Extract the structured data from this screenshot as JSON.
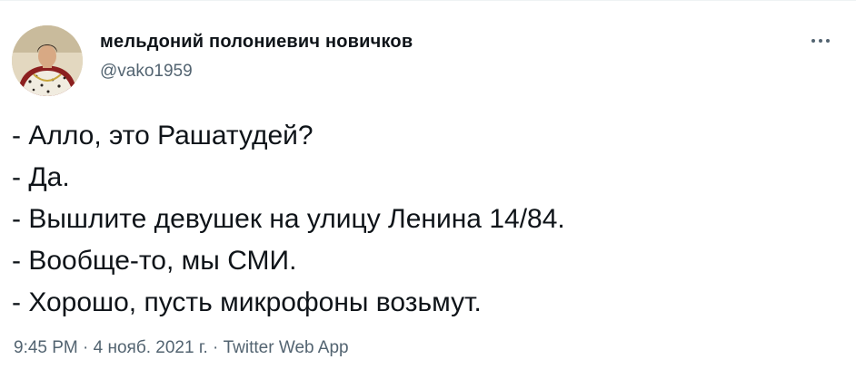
{
  "author": {
    "name": "мельдоний полониевич новичков",
    "handle": "@vako1959",
    "avatar_icon": "avatar-portrait-icon"
  },
  "more_icon": "more-options-icon",
  "tweet": {
    "lines": [
      "- Алло, это Рашатудей?",
      "- Да.",
      "- Вышлите девушек на улицу Ленина 14/84.",
      "- Вообще-то, мы СМИ.",
      "- Хорошо, пусть микрофоны возьмут."
    ]
  },
  "meta": {
    "time": "9:45 PM",
    "separator": " · ",
    "date": "4 нояб. 2021 г.",
    "source": "Twitter Web App"
  },
  "colors": {
    "text": "#0f1419",
    "secondary": "#536471",
    "background": "#ffffff"
  }
}
